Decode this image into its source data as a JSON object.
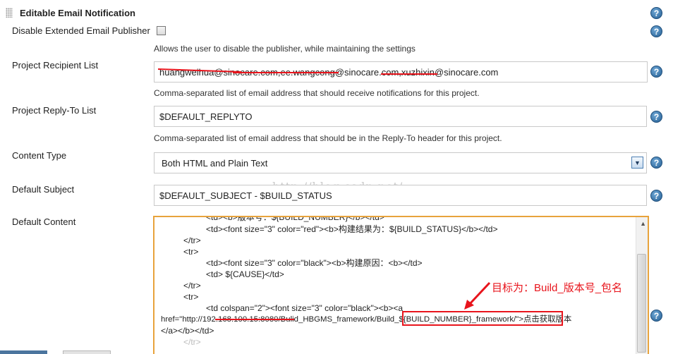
{
  "section": {
    "title": "Editable Email Notification"
  },
  "disable_publisher": {
    "label": "Disable Extended Email Publisher",
    "description": "Allows the user to disable the publisher, while maintaining the settings",
    "checked": false
  },
  "recipient_list": {
    "label": "Project Recipient List",
    "value": "huangweihua@sinocare.com,ee.wangcong@sinocare.com,xuzhixin@sinocare.com",
    "description": "Comma-separated list of email address that should receive notifications for this project."
  },
  "reply_to": {
    "label": "Project Reply-To List",
    "value": "$DEFAULT_REPLYTO",
    "description": "Comma-separated list of email address that should be in the Reply-To header for this project."
  },
  "content_type": {
    "label": "Content Type",
    "selected": "Both HTML and Plain Text"
  },
  "default_subject": {
    "label": "Default Subject",
    "value": "$DEFAULT_SUBJECT - $BUILD_STATUS"
  },
  "default_content": {
    "label": "Default Content",
    "lines": [
      "<td><b>版本号：${BUILD_NUMBER}</b></td>",
      "<td><font size=\"3\" color=\"red\"><b>构建结果为：${BUILD_STATUS}</b></td>",
      "</tr>",
      "<tr>",
      "<td><font size=\"3\" color=\"black\"><b>构建原因：<b></td>",
      "<td> ${CAUSE}</td>",
      "</tr>",
      "<tr>",
      "<td colspan=\"2\"><font size=\"3\" color=\"black\"><b><a",
      "href=\"http://192.168.100.15:8080/Bulid_HBGMS_framework/Build_${BUILD_NUMBER}_framework/\">点击获取版本",
      "</a></b></td>",
      "</tr>"
    ]
  },
  "annotation": {
    "text": "目标为：Build_版本号_包名"
  },
  "watermark": "http://blog.csdn.net/",
  "help_icon": {
    "glyph": "?"
  },
  "colors": {
    "accent_red": "#e8141c",
    "help_blue": "#245e93",
    "focus_orange": "#e8a33c"
  }
}
